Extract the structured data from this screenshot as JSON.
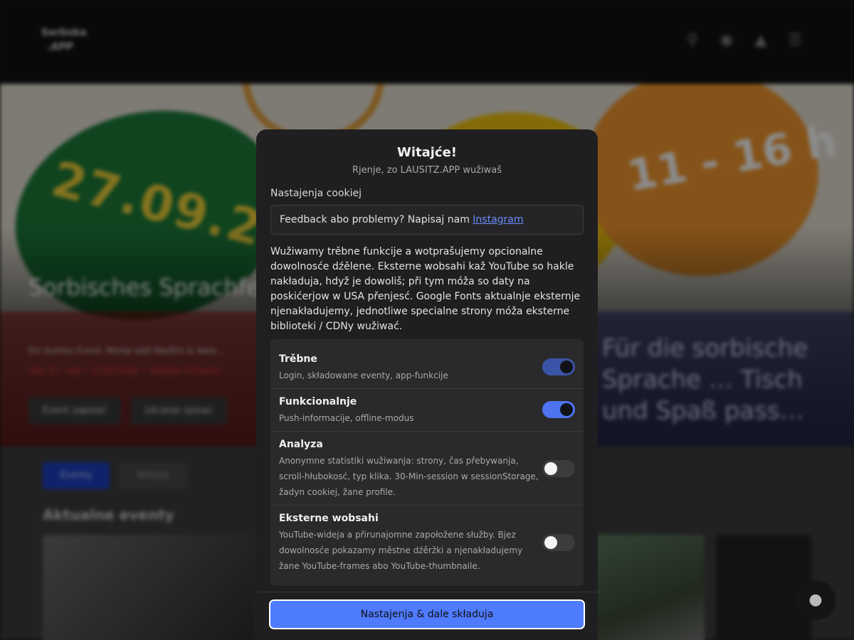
{
  "background": {
    "logo": {
      "line1": "Serbska",
      "line2": ".APP"
    },
    "hero": {
      "date": "27.09.2",
      "time": "11 - 16 h",
      "title": "Sorbisches Sprachfe… jela Scheune in Nochten",
      "right_text": "Für die sorbische Sprache … Tisch und Spaß pass…",
      "subtitle": "Ein buntes Event, Menje wšě Narěče & dwie…",
      "meta": "sob, 27. sep • 11:00 hodź • Stiejela Scheune",
      "buttons": [
        "Event zapisać",
        "Lěcanje spisać"
      ]
    },
    "tabs": [
      "Eventy",
      "Wideja"
    ],
    "section_title": "Aktualne eventy"
  },
  "modal": {
    "title": "Witajće!",
    "subtitle": "Rjenje, zo LAUSITZ.APP wužiwaš",
    "settings_label": "Nastajenja cookiej",
    "feedback": {
      "text": "Feedback abo problemy? Napisaj nam",
      "link": "Instagram"
    },
    "description": "Wužiwamy trěbne funkcije a wotprašujemy opcionalne dowolnosće dźělene. Eksterne wobsahi kaž YouTube so hakle nakładuja, hdyž je dowoliš; při tym móža so daty na poskićerjow w USA přenjesć. Google Fonts aktualnje eksternje njenakładujemy, jednotliwe specialne strony móža eksterne biblioteki / CDNy wužiwać.",
    "toggles": [
      {
        "title": "Trěbne",
        "desc": "Login, składowane eventy, app-funkcije",
        "state": "on",
        "locked": true
      },
      {
        "title": "Funkcionalnje",
        "desc": "Push-informacije, offline-modus",
        "state": "on",
        "locked": false
      },
      {
        "title": "Analyza",
        "desc": "Anonymne statistiki wužiwanja: strony, čas přebywanja, scroll-hłubokosć, typ klika. 30-Min-session w sessionStorage, žadyn cookiej, žane profile.",
        "state": "off",
        "locked": false
      },
      {
        "title": "Eksterne wobsahi",
        "desc": "YouTube-wideja a přirunajomne zapołožene słužby. Bjez dowolnosće pokazamy městne dźěržki a njenakładujemy žane YouTube-frames abo YouTube-thumbnaile.",
        "state": "off",
        "locked": false
      }
    ],
    "save_button": "Nastajenja & dale składuja"
  },
  "colors": {
    "accent": "#4f7bff",
    "modal_bg": "#1f1f21",
    "link": "#6b8cff"
  }
}
